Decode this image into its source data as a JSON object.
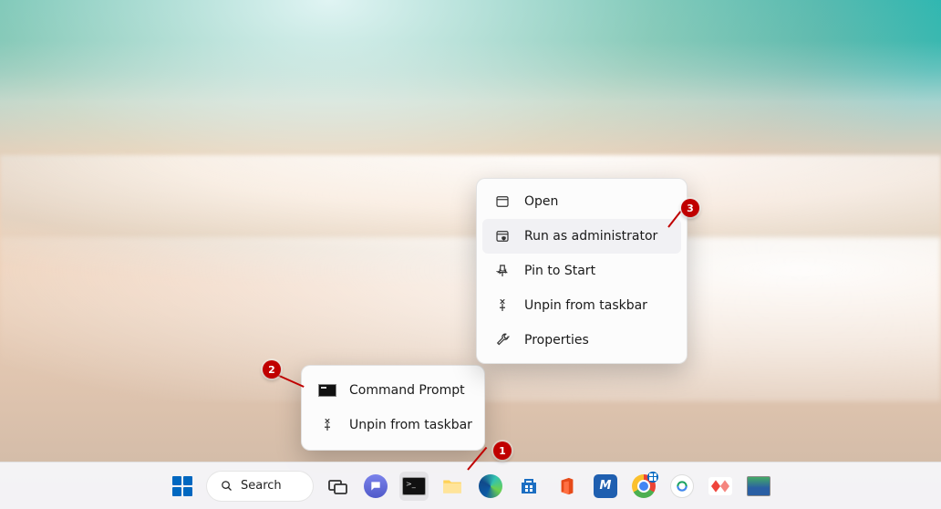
{
  "taskbar": {
    "search_label": "Search",
    "icons": [
      {
        "name": "start"
      },
      {
        "name": "search"
      },
      {
        "name": "task-view"
      },
      {
        "name": "chat"
      },
      {
        "name": "command-prompt"
      },
      {
        "name": "file-explorer"
      },
      {
        "name": "edge"
      },
      {
        "name": "microsoft-store"
      },
      {
        "name": "office"
      },
      {
        "name": "custom-app-m"
      },
      {
        "name": "chrome"
      },
      {
        "name": "remote-desktop"
      },
      {
        "name": "anydesk"
      },
      {
        "name": "image-viewer"
      }
    ]
  },
  "jump_menu": {
    "items": [
      {
        "label": "Command Prompt",
        "icon": "cmd"
      },
      {
        "label": "Unpin from taskbar",
        "icon": "unpin"
      }
    ]
  },
  "sub_menu": {
    "items": [
      {
        "label": "Open",
        "icon": "window"
      },
      {
        "label": "Run as administrator",
        "icon": "admin",
        "hover": true
      },
      {
        "label": "Pin to Start",
        "icon": "pin"
      },
      {
        "label": "Unpin from taskbar",
        "icon": "unpin"
      },
      {
        "label": "Properties",
        "icon": "properties"
      }
    ]
  },
  "annotations": {
    "b1": "1",
    "b2": "2",
    "b3": "3"
  }
}
